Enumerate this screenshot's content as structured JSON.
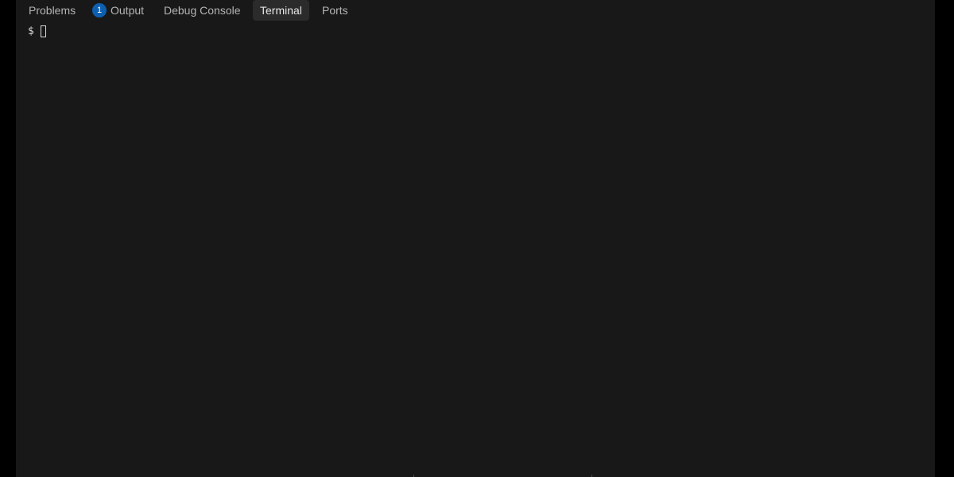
{
  "panel": {
    "tabs": [
      {
        "label": "Problems",
        "badge": "1",
        "active": false
      },
      {
        "label": "Output",
        "active": false
      },
      {
        "label": "Debug Console",
        "active": false
      },
      {
        "label": "Terminal",
        "active": true
      },
      {
        "label": "Ports",
        "active": false
      }
    ]
  },
  "terminal": {
    "prompt": "$",
    "input": ""
  },
  "colors": {
    "window_background": "#000000",
    "panel_background": "#181818",
    "active_tab_background": "#2b2b2b",
    "badge": "#0e5fb0",
    "text": "#b4b4b4"
  }
}
